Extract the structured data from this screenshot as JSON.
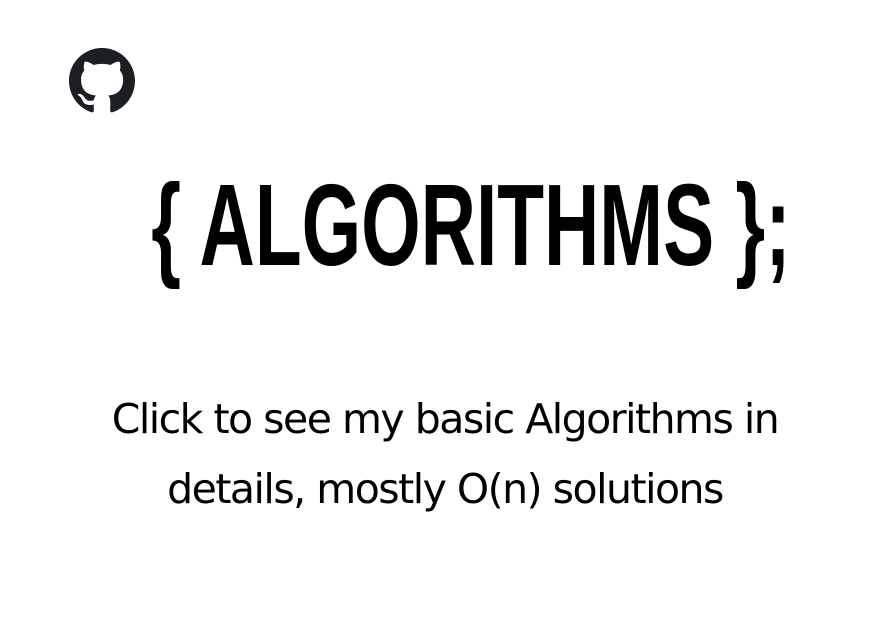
{
  "header": {
    "github_icon": "github-icon"
  },
  "main": {
    "title": "{ ALGORITHMS };",
    "description_line1": "Click to see my basic Algorithms in",
    "description_line2": "details, mostly O(n) solutions"
  },
  "colors": {
    "background": "#ffffff",
    "text": "#000000"
  }
}
